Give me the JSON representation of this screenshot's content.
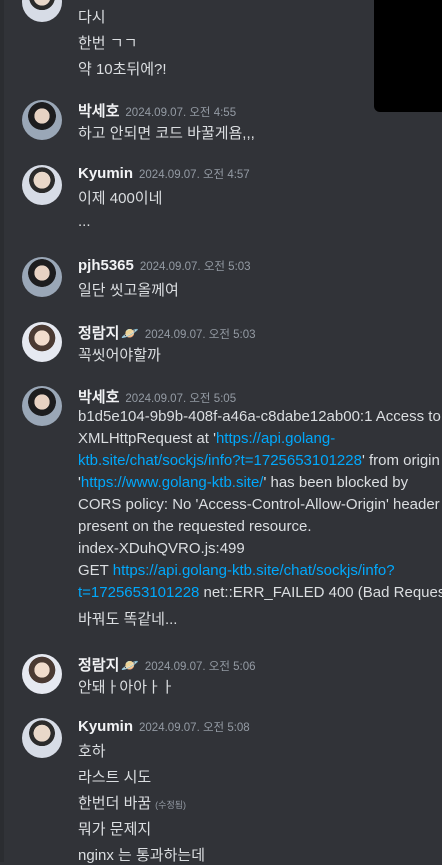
{
  "messages": [
    {
      "lines": [
        "다시",
        "한번 ㄱㄱ",
        "약 10초뒤에?!"
      ]
    },
    {
      "user": "박세호",
      "time": "2024.09.07. 오전 4:55",
      "lines": [
        "하고 안되면 코드 바꿀게욤,,,"
      ]
    },
    {
      "user": "Kyumin",
      "time": "2024.09.07. 오전 4:57",
      "lines": [
        "이제 400이네",
        "..."
      ]
    },
    {
      "user": "pjh5365",
      "time": "2024.09.07. 오전 5:03",
      "lines": [
        "일단 씻고올께여"
      ]
    },
    {
      "user": "정람지",
      "badge": "🪐",
      "time": "2024.09.07. 오전 5:03",
      "lines": [
        "꼭씻어야할까"
      ]
    },
    {
      "user": "박세호",
      "time": "2024.09.07. 오전 5:05",
      "l1": "b1d5e104-9b9b-408f-a46a-c8dabe12ab00:1 Access to",
      "l2a": "XMLHttpRequest at '",
      "l2b": "https://api.golang-",
      "l3a": "ktb.site/chat/sockjs/info?t=1725653101228",
      "l3b": "' from origin",
      "l4a": "'",
      "l4b": "https://www.golang-ktb.site/",
      "l4c": "' has been blocked by",
      "l5": "CORS policy: No 'Access-Control-Allow-Origin' header is",
      "l6": "present on the requested resource.",
      "l7": "index-XDuhQVRO.js:499",
      "l8a": " GET ",
      "l8b": "https://api.golang-ktb.site/chat/sockjs/info?",
      "l9a": "t=1725653101228",
      "l9b": " net::ERR_FAILED 400 (Bad Request)",
      "l10": "바꿔도 똑같네..."
    },
    {
      "user": "정람지",
      "badge": "🪐",
      "time": "2024.09.07. 오전 5:06",
      "lines": [
        "안돼ㅏ아아ㅏㅏ"
      ]
    },
    {
      "user": "Kyumin",
      "time": "2024.09.07. 오전 5:08",
      "lines": [
        "호하",
        "라스트 시도",
        "한번더 바꿈",
        "뭐가 문제지",
        "nginx 는 통과하는데"
      ],
      "edited": "(수정됨)"
    }
  ]
}
